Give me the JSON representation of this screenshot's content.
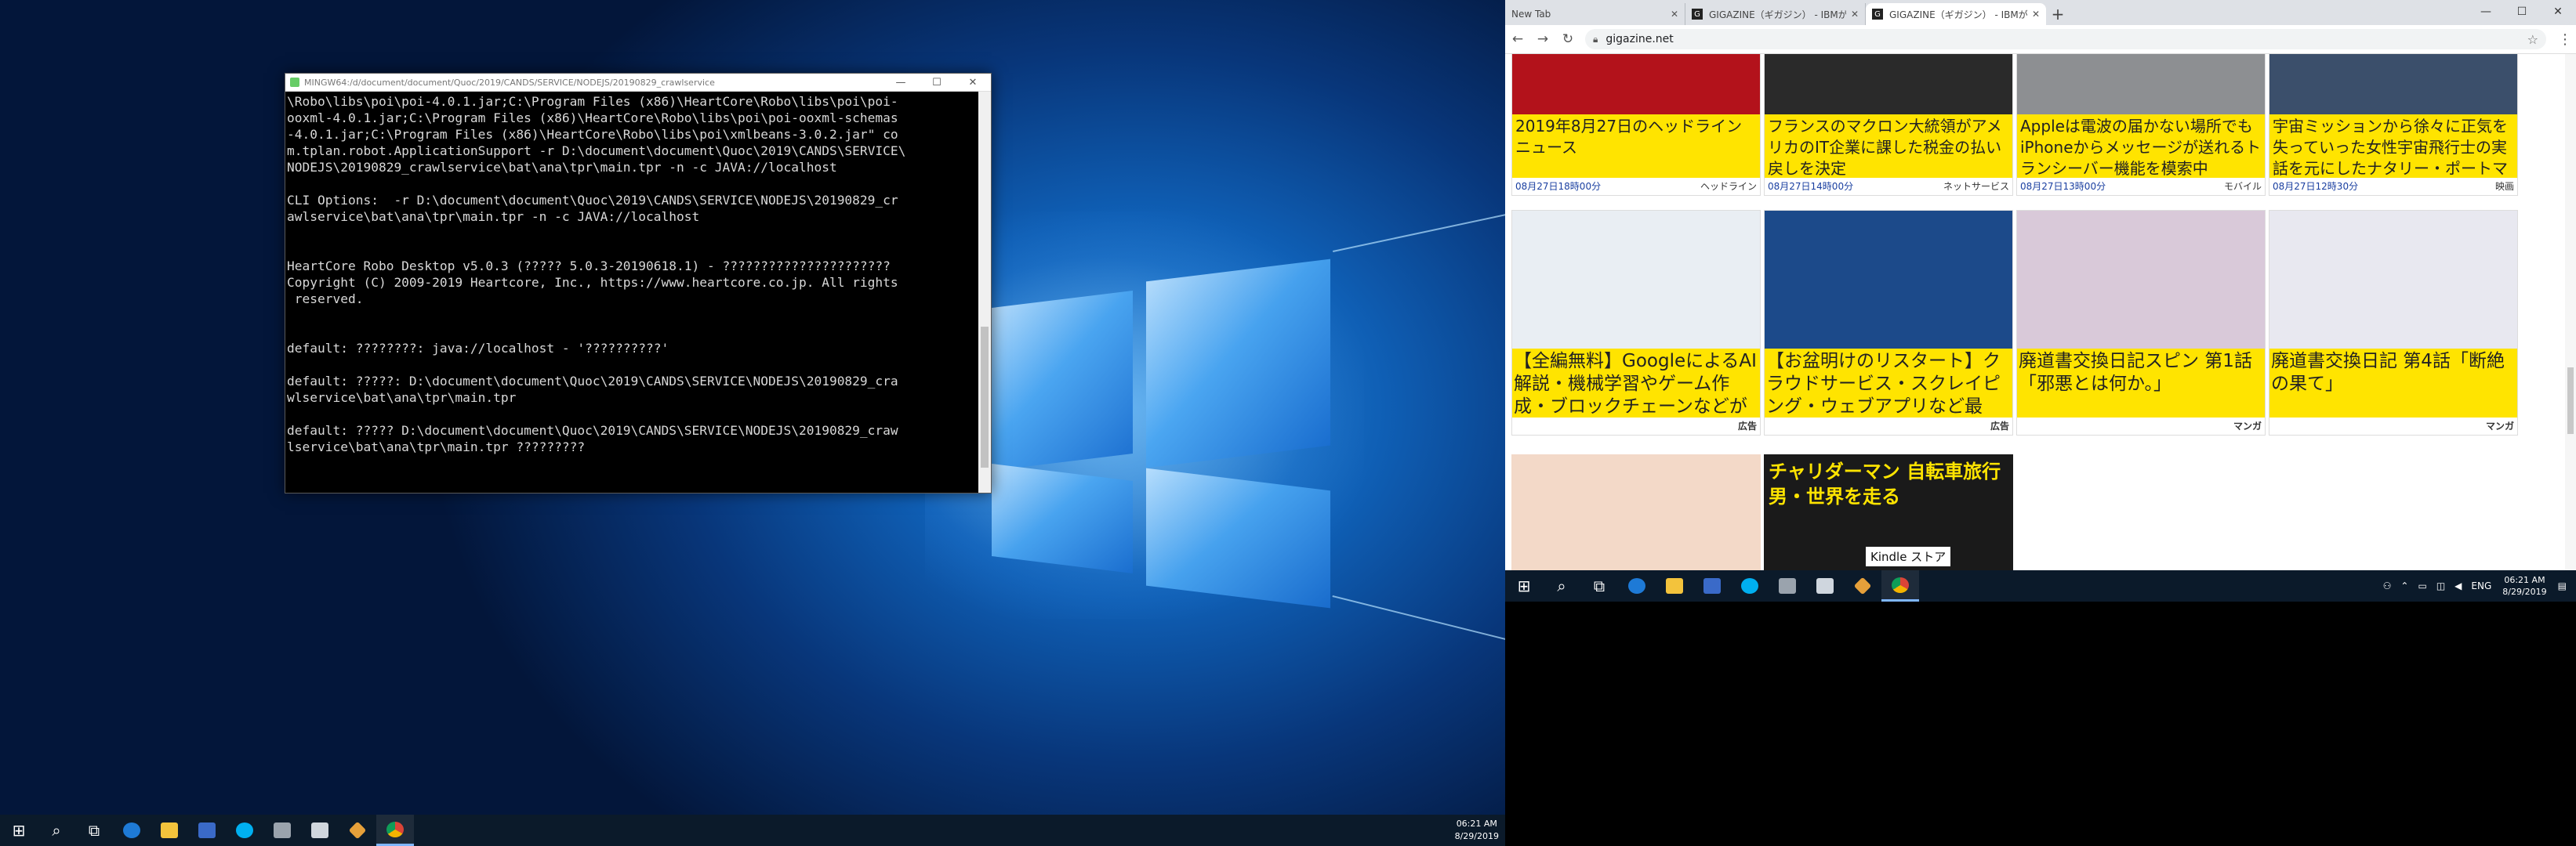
{
  "left_desktop": {
    "terminal": {
      "title": "MINGW64:/d/document/document/Quoc/2019/CANDS/SERVICE/NODEJS/20190829_crawlservice",
      "lines": [
        "\\Robo\\libs\\poi\\poi-4.0.1.jar;C:\\Program Files (x86)\\HeartCore\\Robo\\libs\\poi\\poi-",
        "ooxml-4.0.1.jar;C:\\Program Files (x86)\\HeartCore\\Robo\\libs\\poi\\poi-ooxml-schemas",
        "-4.0.1.jar;C:\\Program Files (x86)\\HeartCore\\Robo\\libs\\poi\\xmlbeans-3.0.2.jar\" co",
        "m.tplan.robot.ApplicationSupport -r D:\\document\\document\\Quoc\\2019\\CANDS\\SERVICE\\",
        "NODEJS\\20190829_crawlservice\\bat\\ana\\tpr\\main.tpr -n -c JAVA://localhost",
        "",
        "CLI Options:  -r D:\\document\\document\\Quoc\\2019\\CANDS\\SERVICE\\NODEJS\\20190829_cr",
        "awlservice\\bat\\ana\\tpr\\main.tpr -n -c JAVA://localhost",
        "",
        "",
        "HeartCore Robo Desktop v5.0.3 (????? 5.0.3-20190618.1) - ??????????????????????",
        "Copyright (C) 2009-2019 Heartcore, Inc., https://www.heartcore.co.jp. All rights",
        " reserved.",
        "",
        "",
        "default: ????????: java://localhost - '??????????'",
        "",
        "default: ?????: D:\\document\\document\\Quoc\\2019\\CANDS\\SERVICE\\NODEJS\\20190829_cra",
        "wlservice\\bat\\ana\\tpr\\main.tpr",
        "",
        "default: ????? D:\\document\\document\\Quoc\\2019\\CANDS\\SERVICE\\NODEJS\\20190829_craw",
        "lservice\\bat\\ana\\tpr\\main.tpr ?????????"
      ]
    },
    "taskbar": {
      "time": "06:21 AM",
      "date": "8/29/2019"
    }
  },
  "right_monitor": {
    "browser": {
      "tabs": [
        {
          "label": "New Tab",
          "favicon": ""
        },
        {
          "label": "GIGAZINE（ギガジン） - IBMが合",
          "favicon": "G"
        },
        {
          "label": "GIGAZINE（ギガジン） - IBMが合",
          "favicon": "G"
        }
      ],
      "new_tab": "+",
      "url": "gigazine.net",
      "articles_row1": [
        {
          "title": "2019年8月27日のヘッドラインニュース",
          "date": "08月27日18時00分",
          "category": "ヘッドライン",
          "thumb_color": "#b3121b"
        },
        {
          "title": "フランスのマクロン大統領がアメリカのIT企業に課した税金の払い戻しを決定",
          "date": "08月27日14時00分",
          "category": "ネットサービス",
          "thumb_color": "#2a2a2a"
        },
        {
          "title": "Appleは電波の届かない場所でもiPhoneからメッセージが送れるトランシーバー機能を模索中",
          "date": "08月27日13時00分",
          "category": "モバイル",
          "thumb_color": "#8d8f92"
        },
        {
          "title": "宇宙ミッションから徐々に正気を失っていった女性宇宙飛行士の実話を元にしたナタリー・ポートマン主演",
          "date": "08月27日12時30分",
          "category": "映画",
          "thumb_color": "#3b4f6b"
        }
      ],
      "articles_row2": [
        {
          "title": "【全編無料】GoogleによるAI解説・機械学習やゲーム作成・ブロックチェーンなどが",
          "category": "広告",
          "thumb_color": "#e9eef3"
        },
        {
          "title": "【お盆明けのリスタート】クラウドサービス・スクレイピング・ウェブアプリなど最",
          "category": "広告",
          "thumb_color": "#1c4a8a"
        },
        {
          "title": "廃道書交換日記スピン 第1話「邪悪とは何か。」",
          "category": "マンガ",
          "thumb_color": "#d9c9d9"
        },
        {
          "title": "廃道書交換日記 第4話「断絶の果て」",
          "category": "マンガ",
          "thumb_color": "#e8e8f0"
        }
      ],
      "articles_row3": [
        {
          "title": "",
          "thumb_color": "#f3d9c8"
        },
        {
          "title": "チャリダーマン 自転車旅行男・世界を走る",
          "badge": "Kindle ストア",
          "thumb_color": "#1a1a1a"
        }
      ]
    },
    "taskbar": {
      "lang": "ENG",
      "time": "06:21 AM",
      "date": "8/29/2019"
    }
  }
}
